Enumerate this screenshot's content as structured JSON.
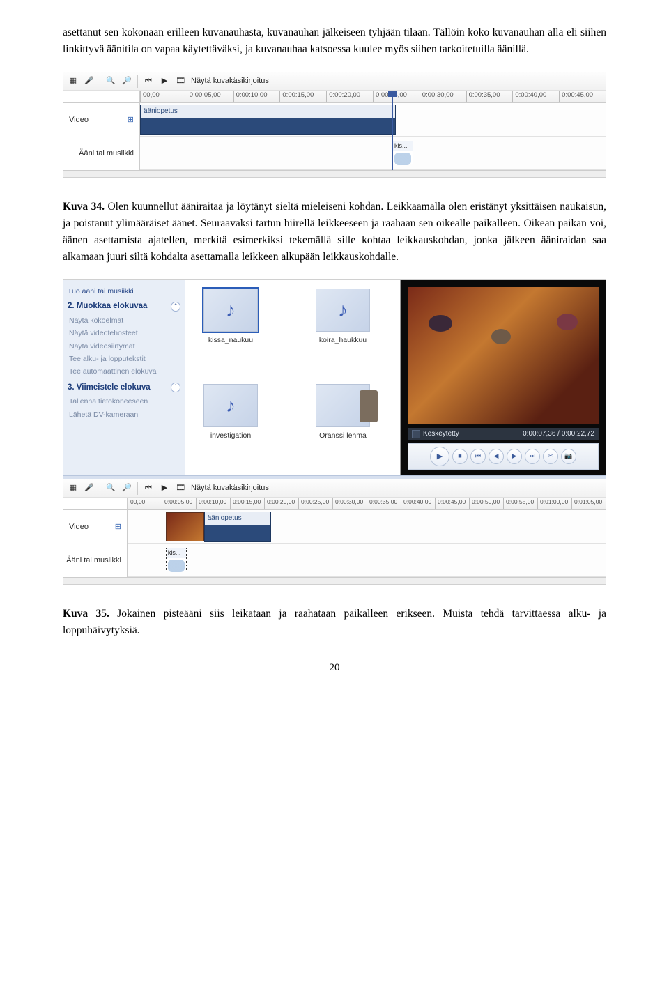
{
  "para1": "asettanut sen kokonaan erilleen kuvanauhasta, kuvanauhan jälkeiseen tyhjään tilaan. Tällöin koko kuvanauhan alla eli siihen linkittyvä äänitila on vapaa käytettäväksi, ja kuvanauhaa katsoessa kuulee myös siihen tarkoitetuilla äänillä.",
  "kuva34_label": "Kuva 34.",
  "kuva34_text": " Olen kuunnellut ääniraitaa ja löytänyt sieltä mieleiseni kohdan. Leikkaamalla olen eristänyt yksittäisen naukaisun, ja poistanut ylimääräiset äänet. Seuraavaksi tartun hiirellä leikkeeseen ja raahaan sen oikealle paikalleen. Oikean paikan voi, äänen asettamista ajatellen, merkitä esimerkiksi tekemällä sille kohtaa leikkauskohdan, jonka jälkeen ääniraidan saa alkamaan juuri siltä kohdalta asettamalla leikkeen alkupään leikkauskohdalle.",
  "kuva35_label": "Kuva 35.",
  "kuva35_text": " Jokainen pisteääni siis leikataan ja raahataan paikalleen erikseen. Muista tehdä tarvittaessa alku- ja loppuhäivytyksiä.",
  "page_num": "20",
  "timeline1": {
    "storyboard_btn": "Näytä kuvakäsikirjoitus",
    "ruler": [
      "00,00",
      "0:00:05,00",
      "0:00:10,00",
      "0:00:15,00",
      "0:00:20,00",
      "0:00:25,00",
      "0:00:30,00",
      "0:00:35,00",
      "0:00:40,00",
      "0:00:45,00"
    ],
    "label_video": "Video",
    "label_audio": "Ääni tai musiikki",
    "clip_video": "ääniopetus",
    "clip_audio": "kis..."
  },
  "mm": {
    "task_top": "Tuo ääni tai musiikki",
    "step2": "2. Muokkaa elokuvaa",
    "sub2": [
      "Näytä kokoelmat",
      "Näytä videotehosteet",
      "Näytä videosiirtymät",
      "Tee alku- ja lopputekstit",
      "Tee automaattinen elokuva"
    ],
    "step3": "3. Viimeistele elokuva",
    "sub3": [
      "Tallenna tietokoneeseen",
      "Lähetä DV-kameraan"
    ],
    "items": [
      "kissa_naukuu",
      "koira_haukkuu",
      "investigation",
      "Oranssi lehmä"
    ],
    "status_label": "Keskeytetty",
    "status_time": "0:00:07,36 / 0:00:22,72"
  },
  "timeline2": {
    "storyboard_btn": "Näytä kuvakäsikirjoitus",
    "ruler": [
      "00,00",
      "0:00:05,00",
      "0:00:10,00",
      "0:00:15,00",
      "0:00:20,00",
      "0:00:25,00",
      "0:00:30,00",
      "0:00:35,00",
      "0:00:40,00",
      "0:00:45,00",
      "0:00:50,00",
      "0:00:55,00",
      "0:01:00,00",
      "0:01:05,00"
    ],
    "label_video": "Video",
    "label_audio": "Ääni tai musiikki",
    "clip_video": "ääniopetus",
    "clip_audio": "kis..."
  }
}
